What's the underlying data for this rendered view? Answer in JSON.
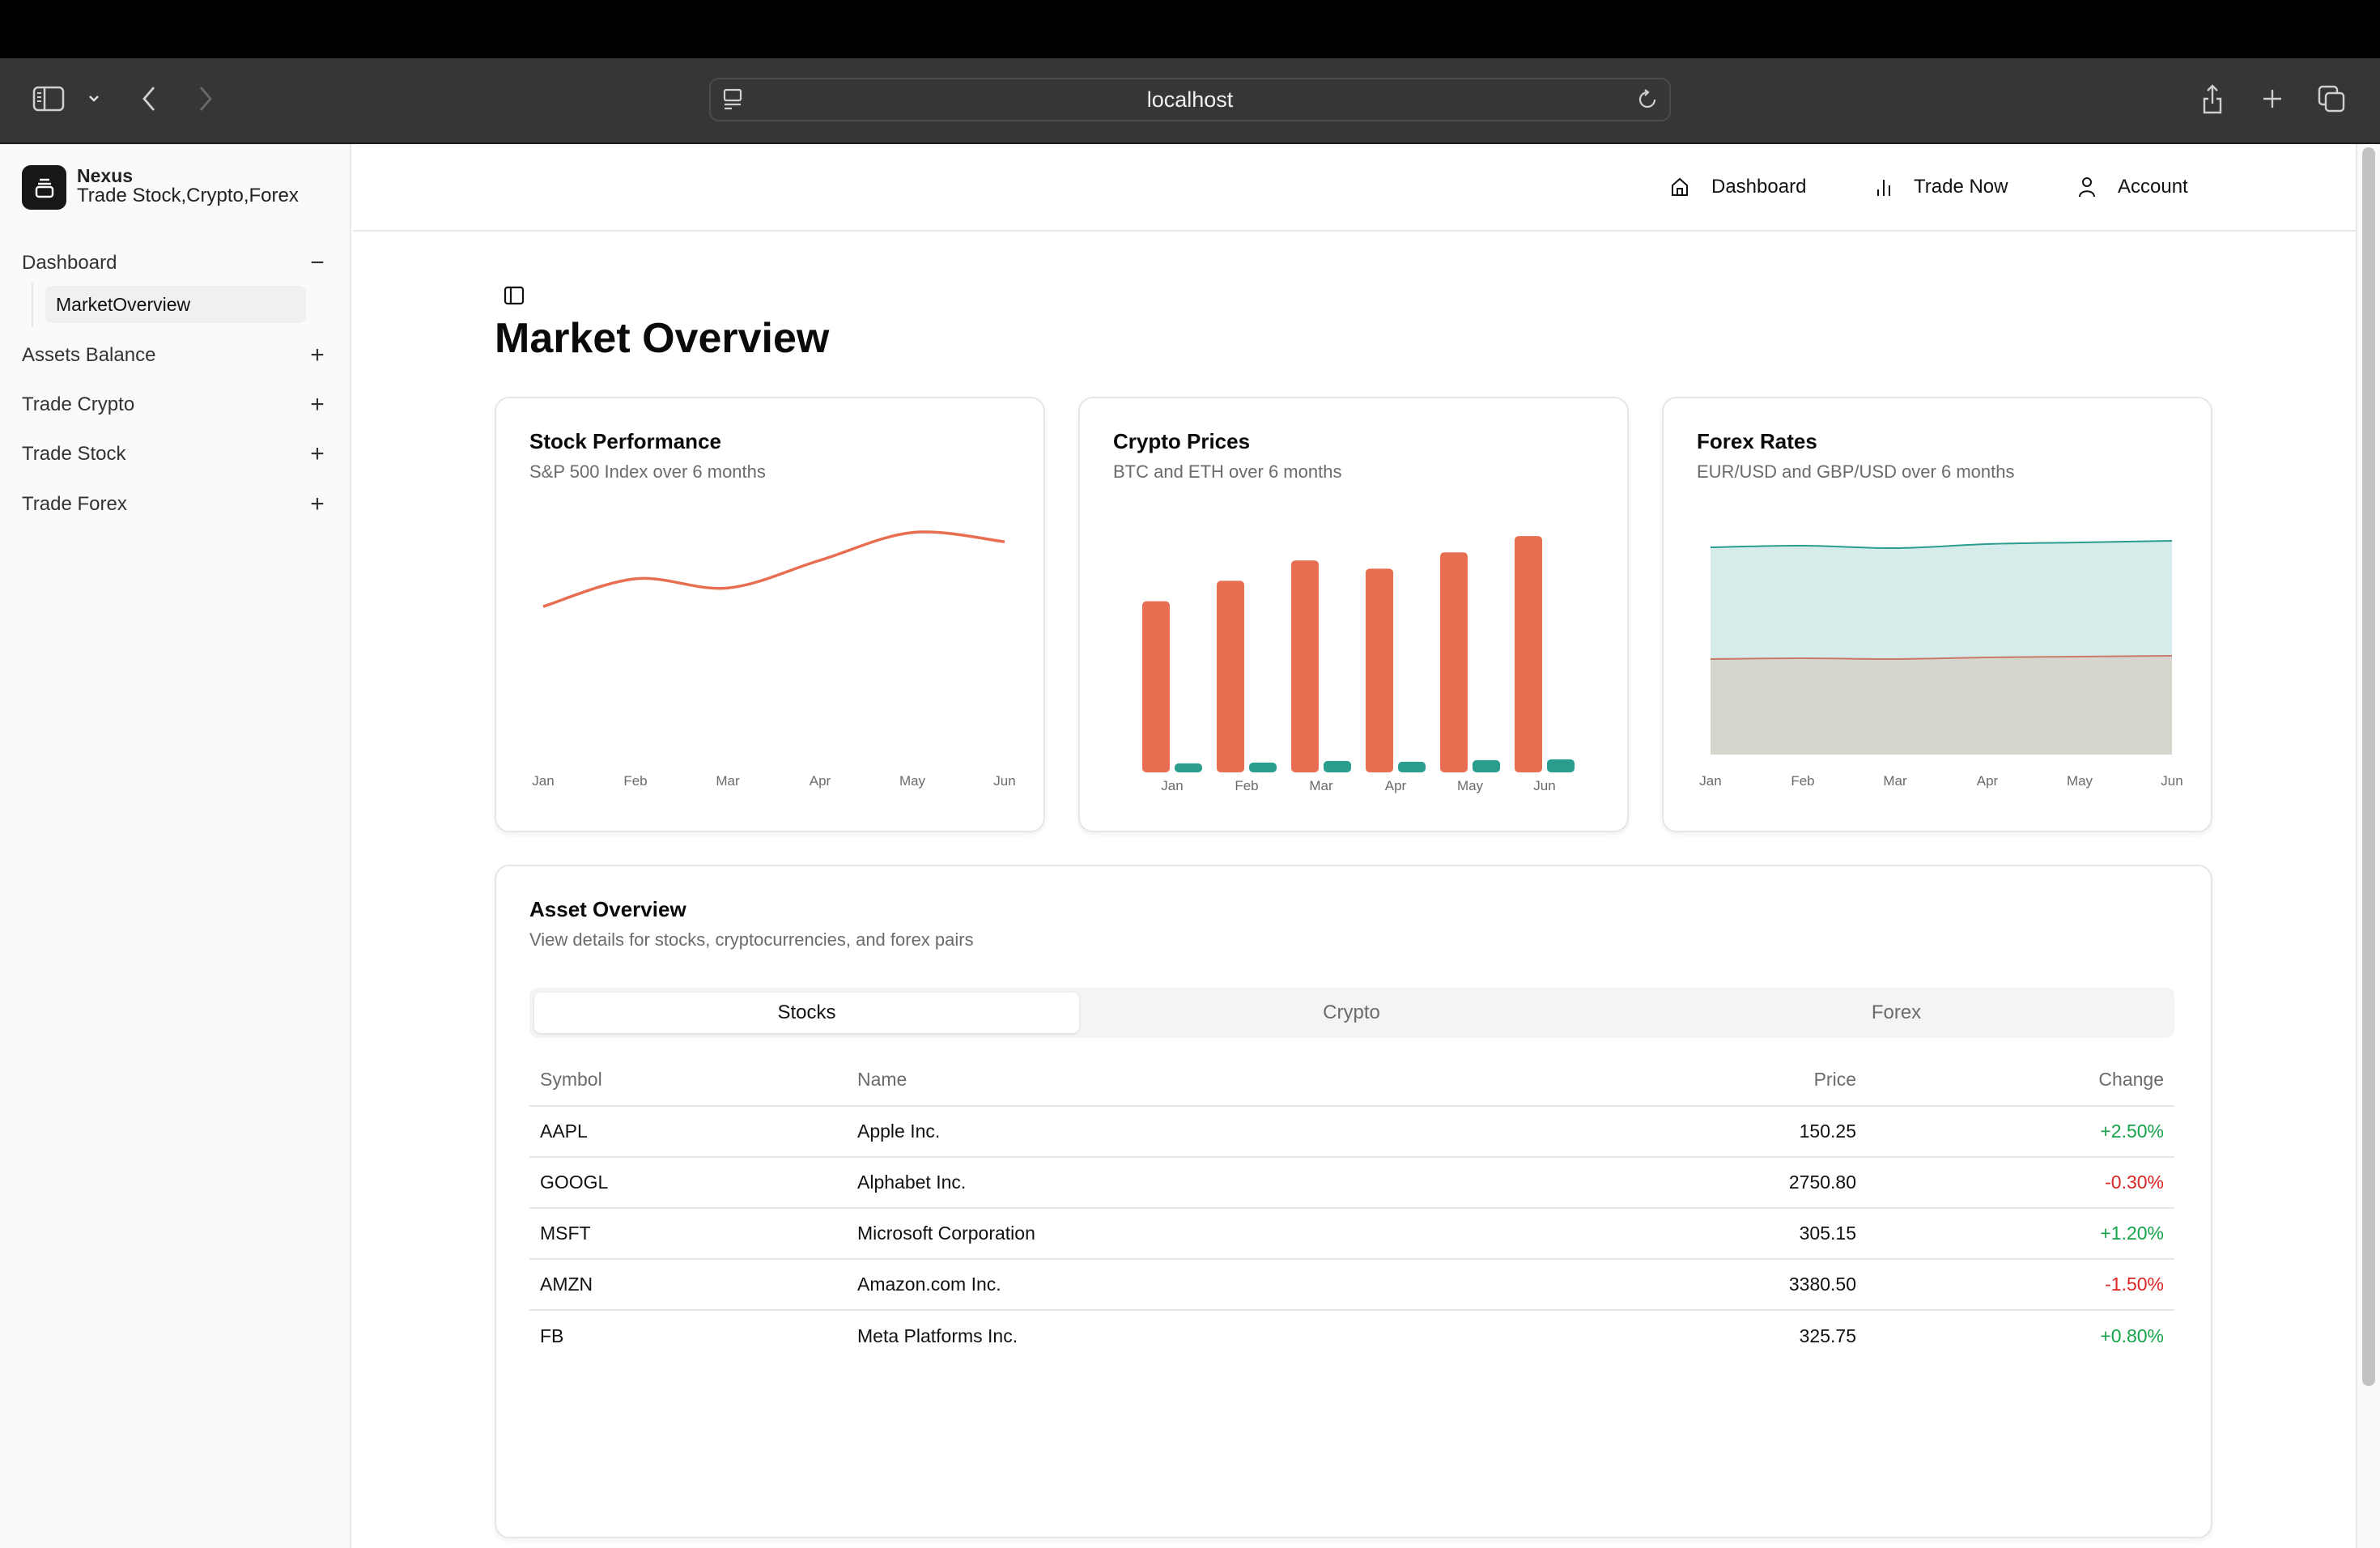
{
  "browser": {
    "url": "localhost"
  },
  "sidebar": {
    "brand_name": "Nexus",
    "brand_tagline": "Trade Stock,Crypto,Forex",
    "groups": [
      {
        "label": "Dashboard",
        "expanded": true,
        "sign": "−",
        "children": [
          {
            "label": "MarketOverview",
            "active": true
          }
        ]
      },
      {
        "label": "Assets Balance",
        "expanded": false,
        "sign": "+"
      },
      {
        "label": "Trade Crypto",
        "expanded": false,
        "sign": "+"
      },
      {
        "label": "Trade Stock",
        "expanded": false,
        "sign": "+"
      },
      {
        "label": "Trade Forex",
        "expanded": false,
        "sign": "+"
      }
    ]
  },
  "header": {
    "nav": [
      {
        "label": "Dashboard",
        "icon": "home-icon"
      },
      {
        "label": "Trade Now",
        "icon": "bar-chart-icon"
      },
      {
        "label": "Account",
        "icon": "user-icon"
      }
    ]
  },
  "main": {
    "title": "Market Overview"
  },
  "cards": {
    "stock": {
      "title": "Stock Performance",
      "subtitle": "S&P 500 Index over 6 months"
    },
    "crypto": {
      "title": "Crypto Prices",
      "subtitle": "BTC and ETH over 6 months"
    },
    "forex": {
      "title": "Forex Rates",
      "subtitle": "EUR/USD and GBP/USD over 6 months"
    }
  },
  "colors": {
    "accent_orange": "#e76e50",
    "accent_teal": "#2a9d8f",
    "area_gray": "#d6d5ce",
    "area_teal": "#d6ecea",
    "positive": "#16a34a",
    "negative": "#dc2626"
  },
  "chart_data": [
    {
      "type": "line",
      "title": "Stock Performance",
      "subtitle": "S&P 500 Index over 6 months",
      "categories": [
        "Jan",
        "Feb",
        "Mar",
        "Apr",
        "May",
        "Jun"
      ],
      "series": [
        {
          "name": "S&P 500",
          "values": [
            4200,
            4350,
            4300,
            4450,
            4600,
            4550
          ]
        }
      ],
      "ylim": [
        3400,
        4800
      ],
      "grid": false,
      "legend": "none"
    },
    {
      "type": "bar",
      "title": "Crypto Prices",
      "subtitle": "BTC and ETH over 6 months",
      "categories": [
        "Jan",
        "Feb",
        "Mar",
        "Apr",
        "May",
        "Jun"
      ],
      "series": [
        {
          "name": "BTC",
          "values": [
            42000,
            47000,
            52000,
            50000,
            54000,
            58000
          ]
        },
        {
          "name": "ETH",
          "values": [
            2200,
            2400,
            2800,
            2600,
            3000,
            3200
          ]
        }
      ],
      "ylim": [
        0,
        60000
      ],
      "grid": false,
      "legend": "none"
    },
    {
      "type": "area",
      "title": "Forex Rates",
      "subtitle": "EUR/USD and GBP/USD over 6 months",
      "categories": [
        "Jan",
        "Feb",
        "Mar",
        "Apr",
        "May",
        "Jun"
      ],
      "stacked": true,
      "series": [
        {
          "name": "EUR/USD",
          "values": [
            1.18,
            1.19,
            1.18,
            1.2,
            1.21,
            1.22
          ]
        },
        {
          "name": "GBP/USD",
          "values": [
            1.38,
            1.39,
            1.37,
            1.4,
            1.41,
            1.42
          ]
        }
      ],
      "ylim": [
        0,
        3.2
      ],
      "grid": false,
      "legend": "none"
    }
  ],
  "assets": {
    "title": "Asset Overview",
    "subtitle": "View details for stocks, cryptocurrencies, and forex pairs",
    "tabs": [
      {
        "label": "Stocks",
        "active": true
      },
      {
        "label": "Crypto",
        "active": false
      },
      {
        "label": "Forex",
        "active": false
      }
    ],
    "columns": [
      "Symbol",
      "Name",
      "Price",
      "Change"
    ],
    "rows": [
      {
        "symbol": "AAPL",
        "name": "Apple Inc.",
        "price": "150.25",
        "change": "+2.50%",
        "direction": "up"
      },
      {
        "symbol": "GOOGL",
        "name": "Alphabet Inc.",
        "price": "2750.80",
        "change": "-0.30%",
        "direction": "down"
      },
      {
        "symbol": "MSFT",
        "name": "Microsoft Corporation",
        "price": "305.15",
        "change": "+1.20%",
        "direction": "up"
      },
      {
        "symbol": "AMZN",
        "name": "Amazon.com Inc.",
        "price": "3380.50",
        "change": "-1.50%",
        "direction": "down"
      },
      {
        "symbol": "FB",
        "name": "Meta Platforms Inc.",
        "price": "325.75",
        "change": "+0.80%",
        "direction": "up"
      }
    ]
  }
}
